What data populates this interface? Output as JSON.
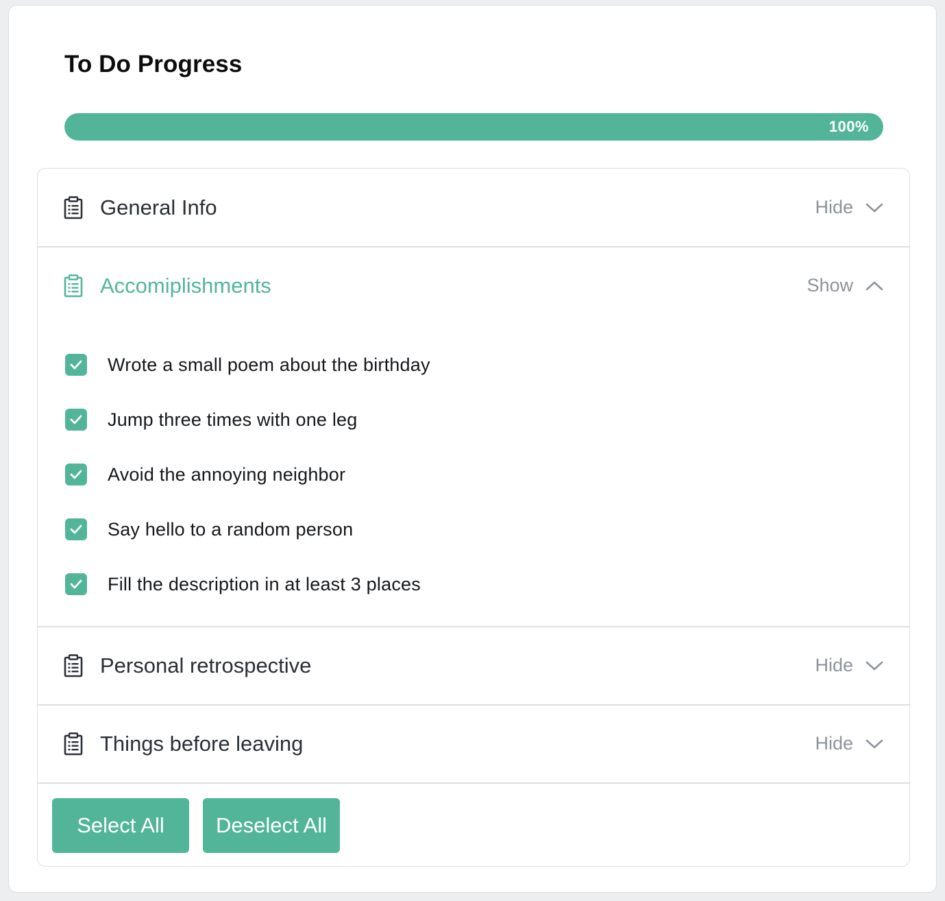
{
  "title": "To Do Progress",
  "progress": {
    "value": 100,
    "label": "100%"
  },
  "colors": {
    "accent": "#52b59a",
    "muted": "#8c939b",
    "text": "#2a2f36"
  },
  "sections": [
    {
      "title": "General Info",
      "toggle": "Hide",
      "icon": "clipboard-icon",
      "chevron": "chevron-down-icon"
    },
    {
      "title": "Accomiplishments",
      "toggle": "Show",
      "icon": "clipboard-icon",
      "chevron": "chevron-up-icon",
      "tasks": [
        {
          "label": "Wrote a small poem about the birthday",
          "checked": true
        },
        {
          "label": "Jump three times with one leg",
          "checked": true
        },
        {
          "label": "Avoid the annoying neighbor",
          "checked": true
        },
        {
          "label": "Say hello to a random person",
          "checked": true
        },
        {
          "label": "Fill the description in at least 3 places",
          "checked": true
        }
      ]
    },
    {
      "title": "Personal retrospective",
      "toggle": "Hide",
      "icon": "clipboard-icon",
      "chevron": "chevron-down-icon"
    },
    {
      "title": "Things before leaving",
      "toggle": "Hide",
      "icon": "clipboard-icon",
      "chevron": "chevron-down-icon"
    }
  ],
  "buttons": {
    "select_all": "Select All",
    "deselect_all": "Deselect All"
  }
}
